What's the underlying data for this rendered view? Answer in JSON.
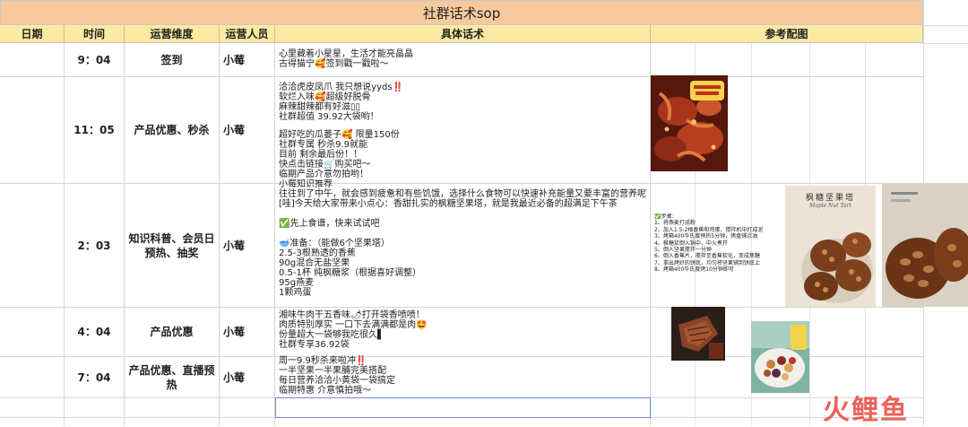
{
  "sheet": {
    "title": "社群话术sop",
    "headers": {
      "date": "日期",
      "time": "时间",
      "dimension": "运营维度",
      "operator": "运营人员",
      "script": "具体话术",
      "images": "参考配图"
    },
    "rows": [
      {
        "time": "9：04",
        "dimension": "签到",
        "operator": "小莓",
        "script": "心里藏着小星星，生活才能亮晶晶\n古得猫宁🥰签到戳一戳啦～"
      },
      {
        "time": "11：05",
        "dimension": "产品优惠、秒杀",
        "operator": "小莓",
        "script_a": "洽洽虎皮凤爪 我只想说yyds‼️\n软烂入味🥰超级好脱骨\n麻辣甜辣都有好滋▯▯\n社群超值 39.92大袋哟！",
        "script_b": "超好吃的瓜蒌子🥰 限量150份\n社群专属 秒杀9.9就能\n目前 剩余最后份！！\n快点击链接🛒购买吧～\n临期产品介意勿拍哟！"
      },
      {
        "time": "2：03",
        "dimension": "知识科普、会员日预热、抽奖",
        "operator": "小莓",
        "script": "小莓知识推荐\n往往到了中午，就会感到疲惫和有些饥饿，选择什么食物可以快速补充能量又要丰富的营养呢\n[哇]今天给大家带来小点心：香甜扎实的枫糖坚果塔，就是我最近必备的超满足下午茶\n\n✅先上食谱，快来试试吧\n\n🥣准备：（能做6个坚果塔）\n2.5-3根熟透的香蕉\n90g混合无盐坚果\n0.5-1杯 纯枫糖浆（根据喜好调整）\n95g燕麦\n1颗鸡蛋",
        "steps": "✅步骤：\n1、将燕麦打成粉\n2、加入1.5-2根香蕉和鸡蛋，搅拌机中打成泥\n3、烤箱400华氏度预热5分钟，烤盘铺点油\n4、枫糖浆倒入锅中，中火煮开\n5、倒入坚果搅拌一分钟\n6、倒入香蕉片，搅拌至香蕉软化，变成焦糖\n7、拿出烤好的饼底，均匀将坚果铺到饼底上\n8、烤箱400华氏度烤10分钟即可",
        "image_caption": "枫糖坚果塔",
        "image_caption_en": "Maple Nut Tart"
      },
      {
        "time": "4：04",
        "dimension": "产品优惠",
        "operator": "小莓",
        "script": "湘味牛肉干五香味🌶打开袋香喷喷！\n肉质特别厚实 一口下去满满都是肉🤩\n份量超大一袋够我吃很久▌\n社群专享36.92袋"
      },
      {
        "time": "7：04",
        "dimension": "产品优惠、直播预热",
        "operator": "小莓",
        "script": "周一9.9秒杀来啦冲‼️\n一半坚果一半果脯完美搭配\n每日营养洽洽小黄袋一袋搞定\n临期特惠 介意慎拍哦～"
      }
    ]
  },
  "watermark": "火鲤鱼",
  "colors": {
    "title_fill": "#f7c99c",
    "header_fill": "#fbeaa0",
    "selection": "#6b8fd8",
    "watermark": "#e8564d"
  }
}
